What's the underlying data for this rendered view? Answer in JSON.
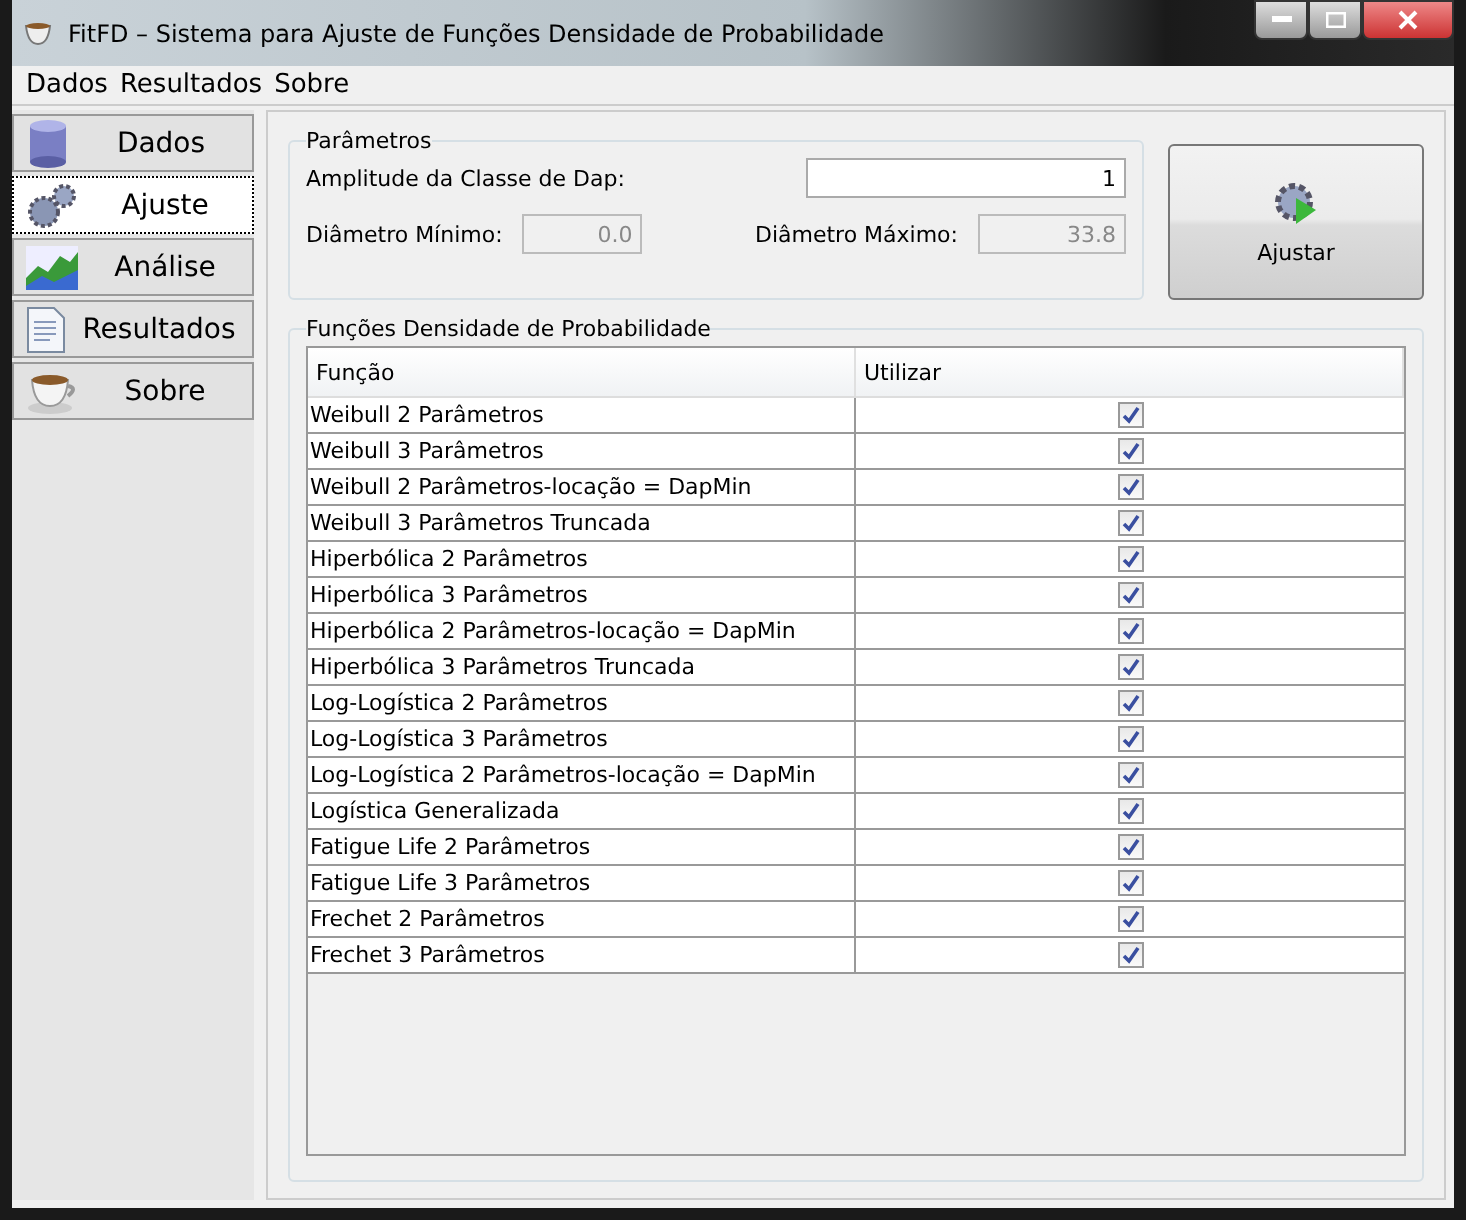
{
  "window": {
    "title": "FitFD – Sistema para Ajuste de Funções Densidade de Probabilidade"
  },
  "menu": [
    "Dados",
    "Resultados",
    "Sobre"
  ],
  "sidebar": {
    "items": [
      {
        "label": "Dados",
        "kind": "database",
        "selected": false
      },
      {
        "label": "Ajuste",
        "kind": "gears",
        "selected": true
      },
      {
        "label": "Análise",
        "kind": "chart",
        "selected": false
      },
      {
        "label": "Resultados",
        "kind": "document",
        "selected": false
      },
      {
        "label": "Sobre",
        "kind": "cup",
        "selected": false
      }
    ]
  },
  "parameters": {
    "title": "Parâmetros",
    "class_width": {
      "label": "Amplitude da Classe de Dap:",
      "value": "1"
    },
    "min": {
      "label": "Diâmetro Mínimo:",
      "value": "0.0",
      "disabled": true
    },
    "max": {
      "label": "Diâmetro Máximo:",
      "value": "33.8",
      "disabled": true
    }
  },
  "fit_button": "Ajustar",
  "functions": {
    "title": "Funções Densidade de Probabilidade",
    "columns": [
      "Função",
      "Utilizar"
    ],
    "rows": [
      {
        "name": "Weibull 2 Parâmetros",
        "checked": true
      },
      {
        "name": "Weibull 3 Parâmetros",
        "checked": true
      },
      {
        "name": "Weibull 2 Parâmetros-locação = DapMin",
        "checked": true
      },
      {
        "name": "Weibull 3 Parâmetros Truncada",
        "checked": true
      },
      {
        "name": "Hiperbólica 2 Parâmetros",
        "checked": true
      },
      {
        "name": "Hiperbólica 3 Parâmetros",
        "checked": true
      },
      {
        "name": "Hiperbólica 2 Parâmetros-locação = DapMin",
        "checked": true
      },
      {
        "name": "Hiperbólica 3 Parâmetros Truncada",
        "checked": true
      },
      {
        "name": "Log-Logística 2 Parâmetros",
        "checked": true
      },
      {
        "name": "Log-Logística 3 Parâmetros",
        "checked": true
      },
      {
        "name": "Log-Logística 2 Parâmetros-locação = DapMin",
        "checked": true
      },
      {
        "name": "Logística Generalizada",
        "checked": true
      },
      {
        "name": "Fatigue Life 2 Parâmetros",
        "checked": true
      },
      {
        "name": "Fatigue Life 3 Parâmetros",
        "checked": true
      },
      {
        "name": "Frechet 2 Parâmetros",
        "checked": true
      },
      {
        "name": "Frechet 3 Parâmetros",
        "checked": true
      }
    ]
  }
}
